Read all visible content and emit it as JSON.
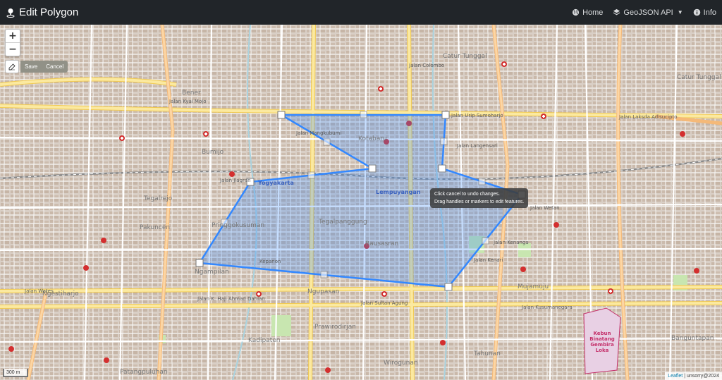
{
  "navbar": {
    "title": "Edit Polygon",
    "links": [
      {
        "label": "Home",
        "icon": "globe-icon"
      },
      {
        "label": "GeoJSON API",
        "icon": "layers-icon"
      },
      {
        "label": "Info",
        "icon": "info-icon"
      }
    ]
  },
  "map_controls": {
    "zoom_in": "+",
    "zoom_out": "−",
    "save_label": "Save",
    "cancel_label": "Cancel"
  },
  "tooltip": {
    "line1": "Click cancel to undo changes.",
    "line2": "Drag handles or markers to edit features."
  },
  "scale": {
    "label": "300 m"
  },
  "attribution": {
    "leaflet": "Leaflet",
    "separator": " | ",
    "credit": "unsorry@2024"
  },
  "map_labels": {
    "jalan_urip_sumoharjo": "Jalan Urip Sumoharjo",
    "jalan_laksda_adisucipto": "Jalan Laksda Adisucipto",
    "jalan_kyai_mojo": "Jalan Kyai Mojo",
    "jalan_colombo": "Jalan Colombo",
    "catur_tunggal": "Catur Tunggal",
    "catur_tunggal_2": "Catur Tunggal",
    "jalan_langensari": "Jalan Langensari",
    "kotabaru": "Kotabaru",
    "bener": "Bener",
    "bumijo": "Bumijo",
    "tegalrejo": "Tegalrejo",
    "pakuncen": "Pakuncen",
    "yogyakarta": "Yogyakarta",
    "lempuyangan": "Lempuyangan",
    "pringgokusuman": "Pringgokusuman",
    "tegalpanggung": "Tegalpanggung",
    "bausasran": "Bausasran",
    "ngampilan": "Ngampilan",
    "kepanon": "Kepanon",
    "ngupasan": "Ngupasan",
    "prawirodirjan": "Prawirodirjan",
    "kadipaten": "Kadipaten",
    "mujamuju": "Mujamuju",
    "wirogunan": "Wirogunan",
    "tahunan": "Tahunan",
    "ngestiharjo": "Ngestiharjo",
    "patangpuluhan": "Patangpuluhan",
    "jalan_kenari": "Jalan Kenari",
    "jalan_sultan_agung": "Jalan Sultan Agung",
    "jalan_kusumanegara": "Jalan Kusumanegara",
    "jalan_wates": "Jalan Wates",
    "jalan_k_haji_ahmad_dahlan": "Jalan K. Haji Ahmad Dahlan",
    "jalan_wetan": "Jalan Wetan",
    "jalan_jlagran": "Jalan Jlagran",
    "kebun_binatang": "Kebun Binatang Gembira Loka",
    "bangunanpan": "Banguntapan",
    "jalan_mangkubumi": "Jalan Mangkubumi",
    "jalan_kenanga": "Jalan Kenanga"
  },
  "colors": {
    "navbar": "#212529",
    "polygon_stroke": "#3388ff",
    "polygon_fill": "#3388ff",
    "road_major": "#f9d977",
    "road_primary": "#fcd6a4",
    "map_background": "#f2efe9"
  }
}
